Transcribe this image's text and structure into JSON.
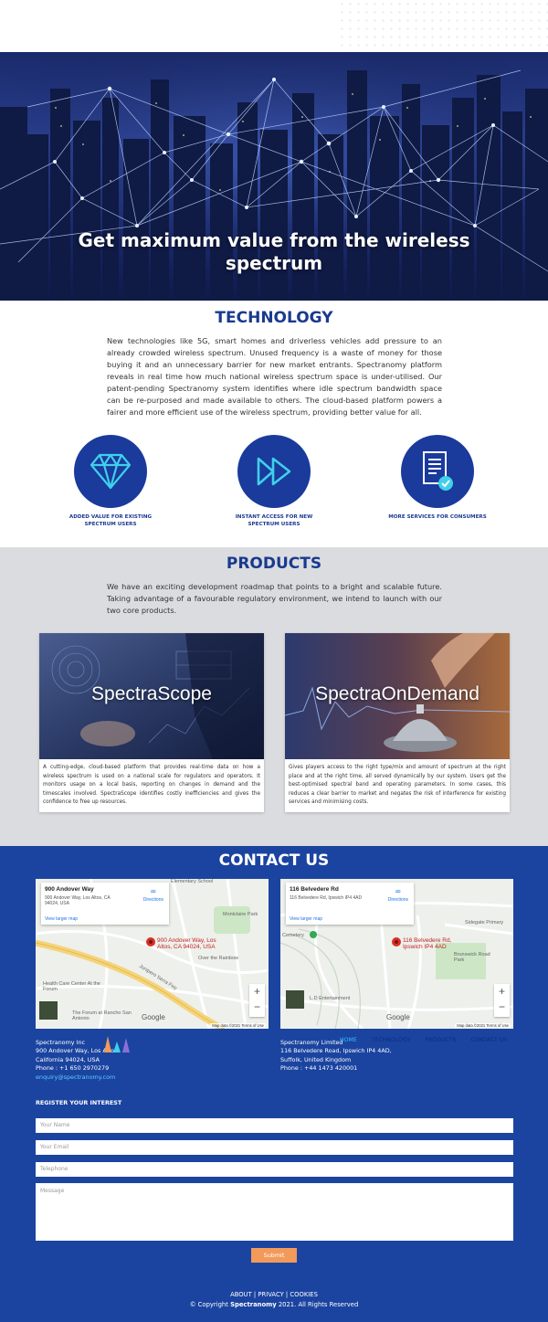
{
  "hero": {
    "title": "Get maximum value from the wireless spectrum"
  },
  "technology": {
    "title": "TECHNOLOGY",
    "paragraph": "New technologies like 5G, smart homes and driverless vehicles add pressure to an already crowded wireless spectrum. Unused frequency is a waste of money for those buying it and an unnecessary barrier for new market entrants. Spectranomy platform reveals in real time how much national wireless spectrum space is under-utilised. Our patent-pending Spectranomy system identifies where idle spectrum bandwidth space can be re-purposed and made available to others. The cloud-based platform powers a fairer and more efficient use of the wireless spectrum, providing better value for all.",
    "features": [
      {
        "icon": "diamond-icon",
        "label": "ADDED VALUE FOR EXISTING SPECTRUM USERS"
      },
      {
        "icon": "fast-forward-icon",
        "label": "INSTANT ACCESS FOR NEW SPECTRUM USERS"
      },
      {
        "icon": "document-check-icon",
        "label": "MORE SERVICES FOR CONSUMERS"
      }
    ]
  },
  "products": {
    "title": "PRODUCTS",
    "paragraph": "We have an exciting development roadmap that points to a bright and scalable future. Taking advantage of a favourable regulatory environment, we intend to launch with our two core products.",
    "items": [
      {
        "name": "SpectraScope",
        "description": "A cutting-edge, cloud-based platform that provides real-time data on how a wireless spectrum is used on a national scale for regulators and operators. It monitors usage on a local basis, reporting on changes in demand and the timescales involved. SpectraScope identifies costly inefficiencies and gives the confidence to free up resources."
      },
      {
        "name": "SpectraOnDemand",
        "description": "Gives players access to the right type/mix and amount of spectrum at the right place and at the right time, all served dynamically by our system. Users get the best-optimised spectral band and operating parameters. In some cases, this reduces a clear barrier to market and negates the risk of interference for existing services and minimising costs."
      }
    ]
  },
  "contact": {
    "title": "CONTACT US",
    "maps": [
      {
        "title": "900 Andover Way",
        "address": "900 Andover Way, Los Altos, CA 94024, USA",
        "directions": "Directions",
        "larger": "View larger map",
        "pin": "900 Andover Way, Los Altos, CA 94024, USA",
        "labels": [
          "Elementary School",
          "Montclaire Park",
          "Over the Rainbow",
          "Health Care Center At the Forum",
          "The Forum at Rancho San Antonio",
          "Junipero Serra Fwy"
        ],
        "google": "Google",
        "mapdata": "Map data ©2021   Terms of Use"
      },
      {
        "title": "116 Belvedere Rd",
        "address": "116 Belvedere Rd, Ipswich IP4 4AD",
        "directions": "Directions",
        "larger": "View larger map",
        "pin": "116 Belvedere Rd, Ipswich IP4 4AD",
        "labels": [
          "Sidegate Primary",
          "Cemetery",
          "Brunswick Road Park",
          "L.D Entertainment"
        ],
        "google": "Google",
        "mapdata": "Map data ©2021   Terms of Use"
      }
    ],
    "us_address": {
      "company": "Spectranomy Inc",
      "line1": "900 Andover Way, Los Altos",
      "line2": "California 94024, USA",
      "phone": "Phone : +1 650 2970279",
      "email": "enquiry@spectranomy.com"
    },
    "uk_address": {
      "company": "Spectranomy Limited",
      "line1": "116 Belvedere Road, Ipswich IP4 4AD,",
      "line2": "Suffolk, United Kingdom",
      "phone": "Phone : +44 1473 420001"
    },
    "nav": [
      "HOME",
      "TECHNOLOGY",
      "PRODUCTS",
      "CONTACT US"
    ]
  },
  "form": {
    "title": "REGISTER YOUR INTEREST",
    "name_placeholder": "Your Name",
    "email_placeholder": "Your Email",
    "phone_placeholder": "Telephone",
    "message_placeholder": "Message",
    "submit": "Submit"
  },
  "footer": {
    "links": [
      "ABOUT",
      "PRIVACY",
      "COOKIES"
    ],
    "copyright_prefix": "© Copyright ",
    "brand": "Spectranomy",
    "copyright_suffix": " 2021. All Rights Reserved"
  },
  "colors": {
    "primary": "#1b44a0",
    "heading": "#1a3a8f",
    "products_bg": "#dadce0",
    "submit": "#f29a5a"
  }
}
